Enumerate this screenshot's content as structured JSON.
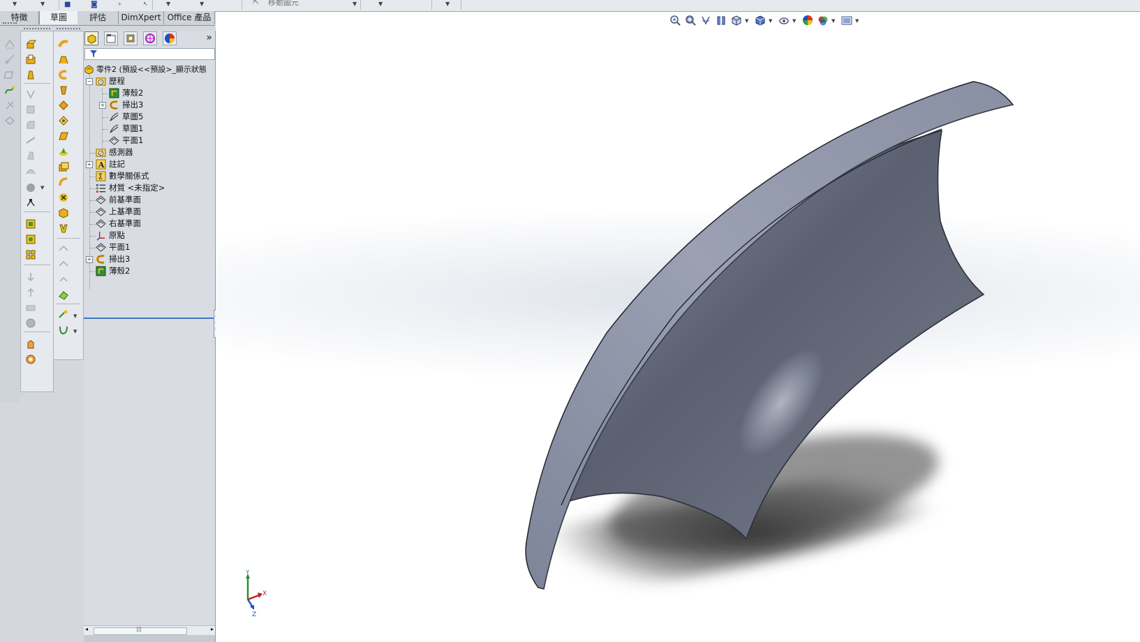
{
  "top_toolbar": {
    "partial_label": "移動圖元"
  },
  "tabs": [
    {
      "label": "特徵",
      "active": false
    },
    {
      "label": "草圖",
      "active": true
    },
    {
      "label": "評估",
      "active": false
    },
    {
      "label": "DimXpert",
      "active": false
    },
    {
      "label": "Office 產品",
      "active": false
    }
  ],
  "feature_manager": {
    "root_label": "零件2 (預設<<預設>_顯示狀態",
    "nodes": [
      {
        "label": "歷程",
        "icon": "history-folder-icon"
      },
      {
        "label": "薄殼2",
        "icon": "shell-icon"
      },
      {
        "label": "掃出3",
        "icon": "sweep-icon"
      },
      {
        "label": "草圖5",
        "icon": "sketch-icon"
      },
      {
        "label": "草圖1",
        "icon": "sketch-icon"
      },
      {
        "label": "平面1",
        "icon": "plane-icon"
      },
      {
        "label": "感測器",
        "icon": "sensor-folder-icon"
      },
      {
        "label": "註記",
        "icon": "annotations-icon"
      },
      {
        "label": "數學關係式",
        "icon": "equations-icon"
      },
      {
        "label": "材質 <未指定>",
        "icon": "material-icon"
      },
      {
        "label": "前基準面",
        "icon": "plane-icon"
      },
      {
        "label": "上基準面",
        "icon": "plane-icon"
      },
      {
        "label": "右基準面",
        "icon": "plane-icon"
      },
      {
        "label": "原點",
        "icon": "origin-icon"
      },
      {
        "label": "平面1",
        "icon": "plane-icon"
      },
      {
        "label": "掃出3",
        "icon": "sweep-icon"
      },
      {
        "label": "薄殼2",
        "icon": "shell-icon"
      }
    ],
    "more_glyph": "»"
  },
  "viewport": {
    "triad": {
      "x": "X",
      "y": "Y",
      "z": "Z"
    }
  },
  "colors": {
    "model_face": "#8f95a8",
    "model_inner_dark": "#4f5565",
    "selection_blue": "#3b78c8"
  }
}
